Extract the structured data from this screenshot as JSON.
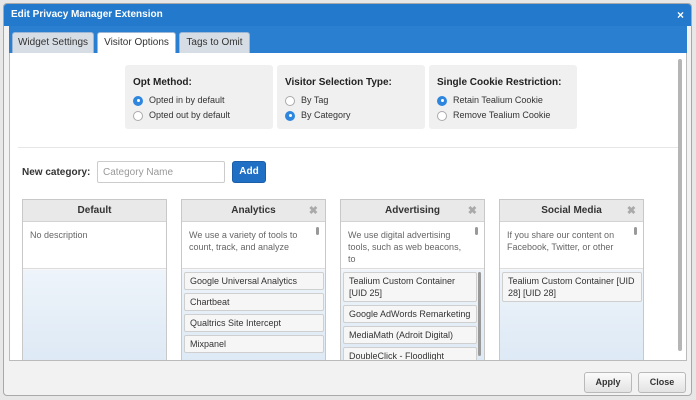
{
  "dialog": {
    "title": "Edit Privacy Manager Extension",
    "close_icon": "×"
  },
  "tabs": [
    {
      "label": "Widget Settings"
    },
    {
      "label": "Visitor Options"
    },
    {
      "label": "Tags to Omit"
    }
  ],
  "options": {
    "opt_method": {
      "title": "Opt Method:",
      "choices": [
        {
          "label": "Opted in by default",
          "selected": true
        },
        {
          "label": "Opted out by default",
          "selected": false
        }
      ]
    },
    "visitor_selection": {
      "title": "Visitor Selection Type:",
      "choices": [
        {
          "label": "By Tag",
          "selected": false
        },
        {
          "label": "By Category",
          "selected": true
        }
      ]
    },
    "single_cookie": {
      "title": "Single Cookie Restriction:",
      "choices": [
        {
          "label": "Retain Tealium Cookie",
          "selected": true
        },
        {
          "label": "Remove Tealium Cookie",
          "selected": false
        }
      ]
    }
  },
  "new_category": {
    "label": "New category:",
    "placeholder": "Category Name",
    "add_label": "Add"
  },
  "categories": [
    {
      "name": "Default",
      "description": "No description",
      "tags": []
    },
    {
      "name": "Analytics",
      "description": "We use a variety of tools to count, track, and analyze",
      "tags": [
        "Google Universal Analytics",
        "Chartbeat",
        "Qualtrics Site Intercept",
        "Mixpanel"
      ]
    },
    {
      "name": "Advertising",
      "description": "We use digital advertising tools, such as web beacons, to",
      "tags": [
        "Tealium Custom Container [UID 25]",
        "Google AdWords Remarketing",
        "MediaMath (Adroit Digital)",
        "DoubleClick - Floodlight"
      ]
    },
    {
      "name": "Social Media",
      "description": "If you share our content on Facebook, Twitter, or other",
      "tags": [
        "Tealium Custom Container [UID 28] [UID 28]"
      ]
    }
  ],
  "footer": {
    "apply_label": "Apply",
    "close_label": "Close"
  },
  "colors": {
    "titlebar": "#2379cc",
    "accent": "#2e86de",
    "add_button": "#1f6fc4"
  }
}
